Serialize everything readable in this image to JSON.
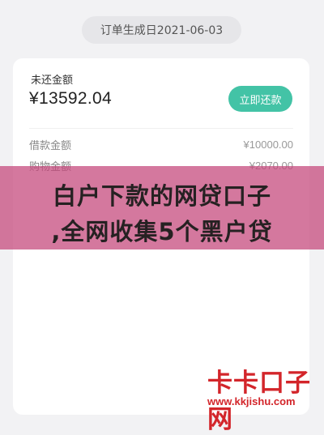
{
  "order": {
    "created_label": "订单生成日2021-06-03"
  },
  "loan": {
    "remaining_label": "未还金额",
    "remaining_amount": "¥13592.04",
    "repay_button": "立即还款",
    "details": [
      {
        "label": "借款金额",
        "value": "¥10000.00"
      },
      {
        "label": "购物金额",
        "value": "¥2070.00"
      }
    ]
  },
  "overlay_banner": {
    "line1": "白户下款的网贷口子",
    "line2": ",全网收集5个黑户贷"
  },
  "watermark": {
    "site_name": "卡卡口子网",
    "url": "www.kkjishu.com"
  },
  "colors": {
    "accent": "#43c3a6",
    "banner": "#c44478",
    "watermark": "#d3252a"
  }
}
